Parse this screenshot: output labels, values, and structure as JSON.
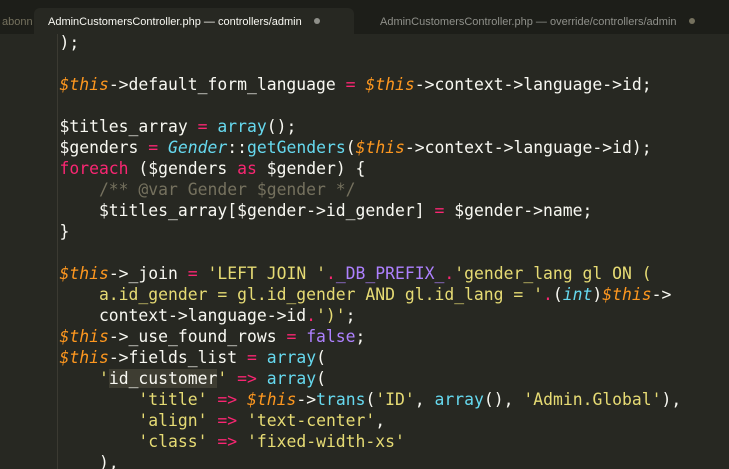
{
  "tabs": [
    {
      "label": "abonn",
      "state": "cut-off"
    },
    {
      "label": "AdminCustomersController.php — controllers/admin",
      "state": "active"
    },
    {
      "label": "AdminCustomersController.php — override/controllers/admin",
      "state": "inactive"
    }
  ],
  "code_lines": [
    [
      [
        "p",
        "    );"
      ]
    ],
    [],
    [
      [
        "var",
        "    $this"
      ],
      [
        "p",
        "->default_form_language "
      ],
      [
        "op",
        "="
      ],
      [
        "p",
        " "
      ],
      [
        "var",
        "$this"
      ],
      [
        "p",
        "->context->language->id;"
      ]
    ],
    [],
    [
      [
        "p",
        "    $titles_array "
      ],
      [
        "op",
        "="
      ],
      [
        "p",
        " "
      ],
      [
        "fn",
        "array"
      ],
      [
        "p",
        "();"
      ]
    ],
    [
      [
        "p",
        "    $genders "
      ],
      [
        "op",
        "="
      ],
      [
        "p",
        " "
      ],
      [
        "cls",
        "Gender"
      ],
      [
        "p",
        "::"
      ],
      [
        "fn",
        "getGenders"
      ],
      [
        "p",
        "("
      ],
      [
        "var",
        "$this"
      ],
      [
        "p",
        "->context->language->id);"
      ]
    ],
    [
      [
        "kw",
        "    foreach"
      ],
      [
        "p",
        " ($genders "
      ],
      [
        "kw",
        "as"
      ],
      [
        "p",
        " $gender) {"
      ]
    ],
    [
      [
        "cmt",
        "        /** @var Gender $gender */"
      ]
    ],
    [
      [
        "p",
        "        $titles_array[$gender->id_gender] "
      ],
      [
        "op",
        "="
      ],
      [
        "p",
        " $gender->name;"
      ]
    ],
    [
      [
        "p",
        "    }"
      ]
    ],
    [],
    [
      [
        "var",
        "    $this"
      ],
      [
        "p",
        "->_join "
      ],
      [
        "op",
        "="
      ],
      [
        "p",
        " "
      ],
      [
        "str",
        "'LEFT JOIN '"
      ],
      [
        "op",
        "."
      ],
      [
        "cst",
        "_DB_PREFIX_"
      ],
      [
        "op",
        "."
      ],
      [
        "str",
        "'gender_lang gl ON ("
      ]
    ],
    [
      [
        "str",
        "        a.id_gender = gl.id_gender AND gl.id_lang = '"
      ],
      [
        "op",
        "."
      ],
      [
        "p",
        "("
      ],
      [
        "typ",
        "int"
      ],
      [
        "p",
        ")"
      ],
      [
        "var",
        "$this"
      ],
      [
        "p",
        "->"
      ]
    ],
    [
      [
        "p",
        "        context->language->id"
      ],
      [
        "op",
        "."
      ],
      [
        "str",
        "')'"
      ],
      [
        "p",
        ";"
      ]
    ],
    [
      [
        "var",
        "    $this"
      ],
      [
        "p",
        "->_use_found_rows "
      ],
      [
        "op",
        "="
      ],
      [
        "p",
        " "
      ],
      [
        "cst",
        "false"
      ],
      [
        "p",
        ";"
      ]
    ],
    [
      [
        "var",
        "    $this"
      ],
      [
        "p",
        "->fields_list "
      ],
      [
        "op",
        "="
      ],
      [
        "p",
        " "
      ],
      [
        "fn",
        "array"
      ],
      [
        "p",
        "("
      ]
    ],
    [
      [
        "p",
        "        "
      ],
      [
        "str",
        "'"
      ],
      [
        "hl",
        "id_customer"
      ],
      [
        "str",
        "'"
      ],
      [
        "p",
        " "
      ],
      [
        "op",
        "=>"
      ],
      [
        "p",
        " "
      ],
      [
        "fn",
        "array"
      ],
      [
        "p",
        "("
      ]
    ],
    [
      [
        "p",
        "            "
      ],
      [
        "str",
        "'title'"
      ],
      [
        "p",
        " "
      ],
      [
        "op",
        "=>"
      ],
      [
        "p",
        " "
      ],
      [
        "var",
        "$this"
      ],
      [
        "p",
        "->"
      ],
      [
        "fn",
        "trans"
      ],
      [
        "p",
        "("
      ],
      [
        "str",
        "'ID'"
      ],
      [
        "p",
        ", "
      ],
      [
        "fn",
        "array"
      ],
      [
        "p",
        "(), "
      ],
      [
        "str",
        "'Admin.Global'"
      ],
      [
        "p",
        "),"
      ]
    ],
    [
      [
        "p",
        "            "
      ],
      [
        "str",
        "'align'"
      ],
      [
        "p",
        " "
      ],
      [
        "op",
        "=>"
      ],
      [
        "p",
        " "
      ],
      [
        "str",
        "'text-center'"
      ],
      [
        "p",
        ","
      ]
    ],
    [
      [
        "p",
        "            "
      ],
      [
        "str",
        "'class'"
      ],
      [
        "p",
        " "
      ],
      [
        "op",
        "=>"
      ],
      [
        "p",
        " "
      ],
      [
        "str",
        "'fixed-width-xs'"
      ]
    ],
    [
      [
        "p",
        "        ),"
      ]
    ]
  ]
}
